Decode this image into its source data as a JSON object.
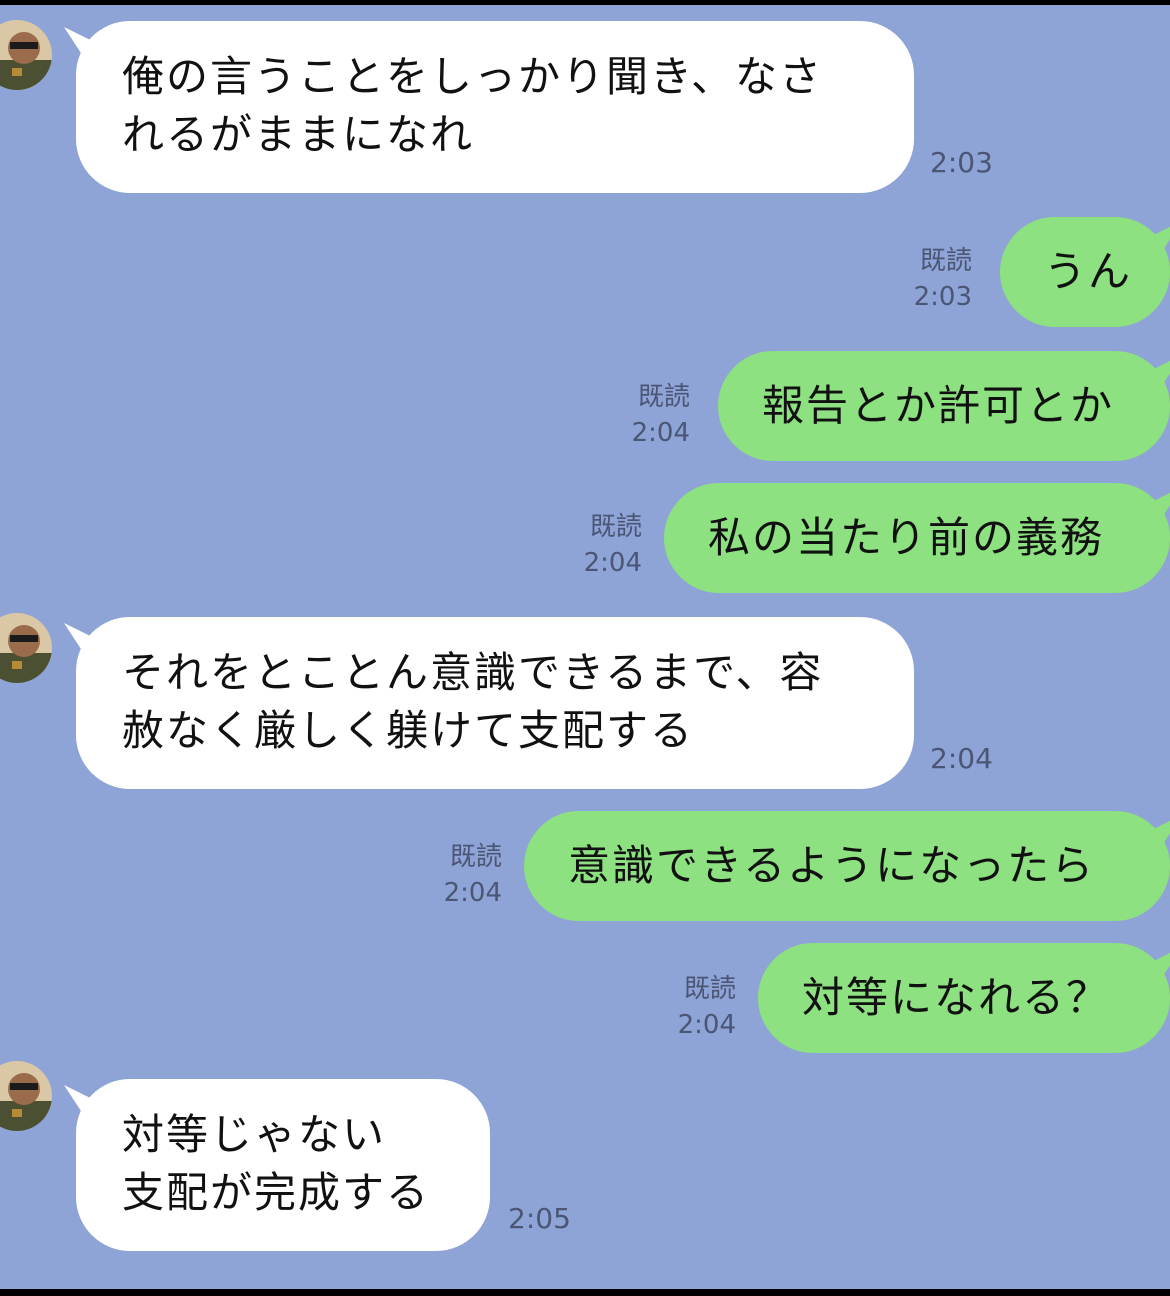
{
  "colors": {
    "background": "#8ea3d6",
    "incoming_bubble": "#ffffff",
    "outgoing_bubble": "#8de180",
    "meta_text": "#4b5675"
  },
  "read_label": "既読",
  "messages": [
    {
      "direction": "incoming",
      "lines": [
        "俺の言うことをしっかり聞き、なさ",
        "れるがままになれ"
      ],
      "time": "2:03"
    },
    {
      "direction": "outgoing",
      "lines": [
        "うん"
      ],
      "read": "既読",
      "time": "2:03"
    },
    {
      "direction": "outgoing",
      "lines": [
        "報告とか許可とか"
      ],
      "read": "既読",
      "time": "2:04"
    },
    {
      "direction": "outgoing",
      "lines": [
        "私の当たり前の義務"
      ],
      "read": "既読",
      "time": "2:04"
    },
    {
      "direction": "incoming",
      "lines": [
        "それをとことん意識できるまで、容",
        "赦なく厳しく躾けて支配する"
      ],
      "time": "2:04"
    },
    {
      "direction": "outgoing",
      "lines": [
        "意識できるようになったら"
      ],
      "read": "既読",
      "time": "2:04"
    },
    {
      "direction": "outgoing",
      "lines": [
        "対等になれる？"
      ],
      "read": "既読",
      "time": "2:04"
    },
    {
      "direction": "incoming",
      "lines": [
        "対等じゃない",
        "支配が完成する"
      ],
      "time": "2:05"
    }
  ]
}
